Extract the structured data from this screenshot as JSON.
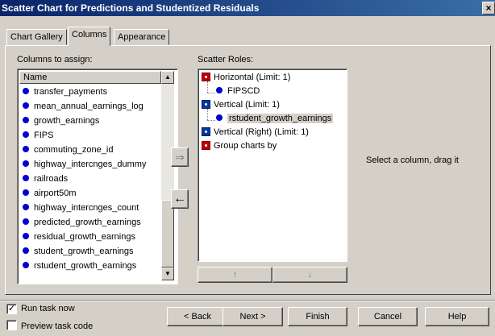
{
  "window": {
    "title": "Scatter Chart for Predictions and Studentized Residuals",
    "close_glyph": "×"
  },
  "tabs": [
    {
      "label": "Chart Gallery",
      "active": false
    },
    {
      "label": "Columns",
      "active": true
    },
    {
      "label": "Appearance",
      "active": false
    }
  ],
  "columns_panel": {
    "label": "Columns to assign:",
    "header": "Name",
    "items": [
      "transfer_payments",
      "mean_annual_earnings_log",
      "growth_earnings",
      "FIPS",
      "commuting_zone_id",
      "highway_intercnges_dummy",
      "railroads",
      "airport50m",
      "highway_intercnges_count",
      "predicted_growth_earnings",
      "residual_growth_earnings",
      "student_growth_earnings",
      "rstudent_growth_earnings"
    ]
  },
  "roles_panel": {
    "label": "Scatter Roles:",
    "roles": [
      {
        "label": "Horizontal  (Limit: 1)",
        "icon": "red"
      },
      {
        "label": "FIPSCD",
        "child": true
      },
      {
        "label": "Vertical  (Limit: 1)",
        "icon": "blue"
      },
      {
        "label": "rstudent_growth_earnings",
        "child": true,
        "selected": true
      },
      {
        "label": "Vertical (Right)  (Limit: 1)",
        "icon": "blue"
      },
      {
        "label": "Group charts by",
        "icon": "red"
      }
    ],
    "move_up_glyph": "↑",
    "move_down_glyph": "↓"
  },
  "help_text": "Select a column, drag it",
  "arrows": {
    "assign": "⇒",
    "remove": "←"
  },
  "options": {
    "run_task_now": {
      "label": "Run task now",
      "checked": true,
      "mark": "✓"
    },
    "preview_task_code": {
      "label": "Preview task code",
      "checked": false
    }
  },
  "buttons": {
    "back": "< Back",
    "next": "Next >",
    "finish": "Finish",
    "cancel": "Cancel",
    "help": "Help"
  },
  "colors": {
    "title_bar_start": "#0a246a",
    "title_bar_end": "#3a6ea5",
    "face": "#d4d0c8",
    "bullet": "#0000d0"
  }
}
